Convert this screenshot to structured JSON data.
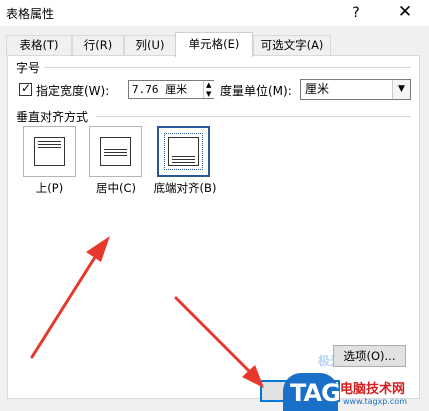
{
  "window": {
    "title": "表格属性",
    "help_glyph": "?",
    "close_glyph": "✕"
  },
  "tabs": [
    {
      "label": "表格(T)"
    },
    {
      "label": "行(R)"
    },
    {
      "label": "列(U)"
    },
    {
      "label": "单元格(E)",
      "active": true
    },
    {
      "label": "可选文字(A)"
    }
  ],
  "size_group": {
    "label": "字号",
    "specify_width_label": "指定宽度(W):",
    "specify_width_checked": true,
    "width_value": "7.76 厘米",
    "measure_label": "度量单位(M):",
    "measure_value": "厘米"
  },
  "vertical_align": {
    "label": "垂直对齐方式",
    "options": [
      {
        "label": "上(P)"
      },
      {
        "label": "居中(C)"
      },
      {
        "label": "底端对齐(B)",
        "selected": true
      }
    ]
  },
  "buttons": {
    "options_label": "选项(O)..."
  },
  "watermark": {
    "brand": "TAG",
    "site": "电脑技术网",
    "url": "www.tagxp.com",
    "overlay": "极光下载站"
  },
  "colors": {
    "annotation_arrow": "#e8372c",
    "selection_border": "#2b5797",
    "focus_border": "#0078d7"
  }
}
